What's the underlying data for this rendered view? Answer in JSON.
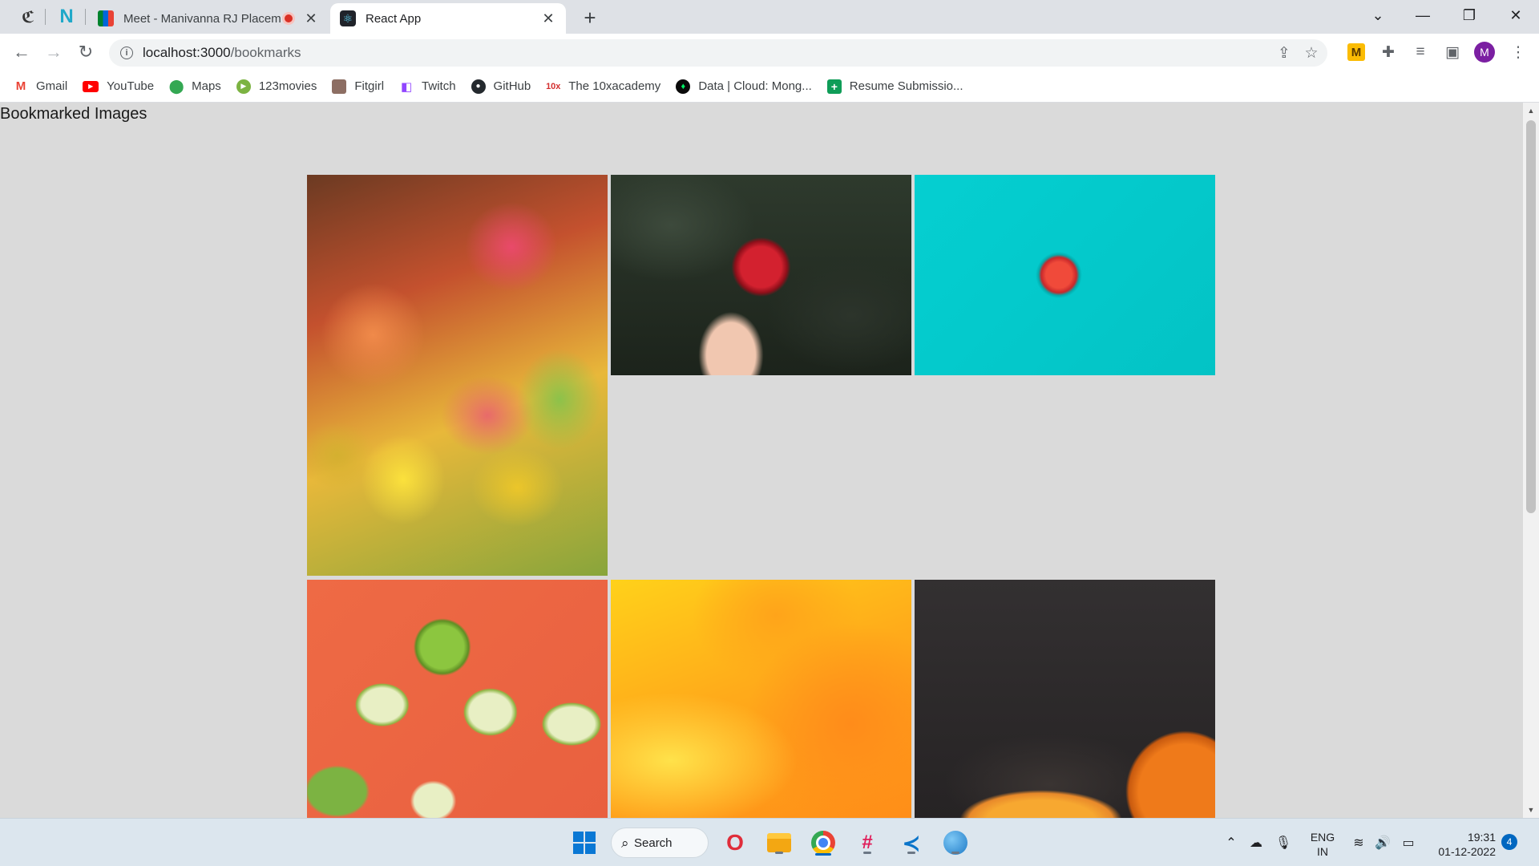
{
  "browser": {
    "tabs": [
      {
        "title": "Meet - Manivanna RJ Placem",
        "recording": true
      },
      {
        "title": "React App",
        "active": true
      }
    ],
    "address": {
      "host": "localhost:3000",
      "path": "/bookmarks"
    },
    "profile_initial": "M",
    "extension_badge": "M",
    "bookmarks": [
      {
        "label": "Gmail",
        "icon": "gmail-icon"
      },
      {
        "label": "YouTube",
        "icon": "youtube-icon"
      },
      {
        "label": "Maps",
        "icon": "maps-icon"
      },
      {
        "label": "123movies",
        "icon": "play-icon"
      },
      {
        "label": "Fitgirl",
        "icon": "fitgirl-icon"
      },
      {
        "label": "Twitch",
        "icon": "twitch-icon"
      },
      {
        "label": "GitHub",
        "icon": "github-icon"
      },
      {
        "label": "The 10xacademy",
        "icon": "tenx-icon"
      },
      {
        "label": "Data | Cloud: Mong...",
        "icon": "mongodb-icon"
      },
      {
        "label": "Resume Submissio...",
        "icon": "sheets-icon"
      }
    ]
  },
  "page": {
    "heading": "Bookmarked Images",
    "images": [
      {
        "subject": "mangoes",
        "icon": "image"
      },
      {
        "subject": "red apple in hand",
        "icon": "image"
      },
      {
        "subject": "red apple on teal",
        "icon": "image"
      },
      {
        "subject": "green apples on orange",
        "icon": "image"
      },
      {
        "subject": "orange yellow fluid",
        "icon": "image"
      },
      {
        "subject": "orange on dark",
        "icon": "image"
      }
    ]
  },
  "taskbar": {
    "search_label": "Search",
    "language": {
      "line1": "ENG",
      "line2": "IN"
    },
    "clock": {
      "time": "19:31",
      "date": "01-12-2022"
    },
    "notification_count": "4"
  },
  "colors": {
    "accent": "#0067c0",
    "page_bg": "#dadada",
    "tab_strip": "#dee1e6"
  }
}
